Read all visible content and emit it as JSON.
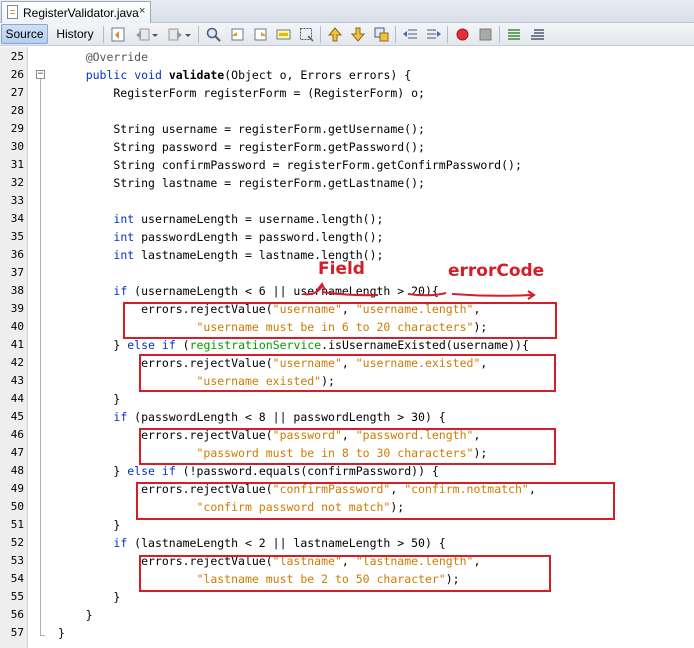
{
  "tab": {
    "filename": "RegisterValidator.java",
    "close": "×"
  },
  "toolbar": {
    "source": "Source",
    "history": "History"
  },
  "annotations": {
    "field": "Field",
    "errorCode": "errorCode",
    "color": "#d21f2a"
  },
  "colors": {
    "keyword": "#0033cc",
    "string": "#ce7b00",
    "field": "#009900",
    "highlight": "#d21f2a"
  },
  "code_lines": [
    {
      "n": "25",
      "t": "    @Override"
    },
    {
      "n": "26",
      "t": "    public void validate(Object o, Errors errors) {"
    },
    {
      "n": "27",
      "t": "        RegisterForm registerForm = (RegisterForm) o;"
    },
    {
      "n": "28",
      "t": ""
    },
    {
      "n": "29",
      "t": "        String username = registerForm.getUsername();"
    },
    {
      "n": "30",
      "t": "        String password = registerForm.getPassword();"
    },
    {
      "n": "31",
      "t": "        String confirmPassword = registerForm.getConfirmPassword();"
    },
    {
      "n": "32",
      "t": "        String lastname = registerForm.getLastname();"
    },
    {
      "n": "33",
      "t": ""
    },
    {
      "n": "34",
      "t": "        int usernameLength = username.length();"
    },
    {
      "n": "35",
      "t": "        int passwordLength = password.length();"
    },
    {
      "n": "36",
      "t": "        int lastnameLength = lastname.length();"
    },
    {
      "n": "37",
      "t": ""
    },
    {
      "n": "38",
      "t": "        if (usernameLength < 6 || usernameLength > 20){"
    },
    {
      "n": "39",
      "t": "            errors.rejectValue(\"username\", \"username.length\","
    },
    {
      "n": "40",
      "t": "                    \"username must be in 6 to 20 characters\");"
    },
    {
      "n": "41",
      "t": "        } else if (registrationService.isUsernameExisted(username)){"
    },
    {
      "n": "42",
      "t": "            errors.rejectValue(\"username\", \"username.existed\","
    },
    {
      "n": "43",
      "t": "                    \"username existed\");"
    },
    {
      "n": "44",
      "t": "        }"
    },
    {
      "n": "45",
      "t": "        if (passwordLength < 8 || passwordLength > 30) {"
    },
    {
      "n": "46",
      "t": "            errors.rejectValue(\"password\", \"password.length\","
    },
    {
      "n": "47",
      "t": "                    \"password must be in 8 to 30 characters\");"
    },
    {
      "n": "48",
      "t": "        } else if (!password.equals(confirmPassword)) {"
    },
    {
      "n": "49",
      "t": "            errors.rejectValue(\"confirmPassword\", \"confirm.notmatch\","
    },
    {
      "n": "50",
      "t": "                    \"confirm password not match\");"
    },
    {
      "n": "51",
      "t": "        }"
    },
    {
      "n": "52",
      "t": "        if (lastnameLength < 2 || lastnameLength > 50) {"
    },
    {
      "n": "53",
      "t": "            errors.rejectValue(\"lastname\", \"lastname.length\","
    },
    {
      "n": "54",
      "t": "                    \"lastname must be 2 to 50 character\");"
    },
    {
      "n": "55",
      "t": "        }"
    },
    {
      "n": "56",
      "t": "    }"
    },
    {
      "n": "57",
      "t": "}"
    }
  ]
}
